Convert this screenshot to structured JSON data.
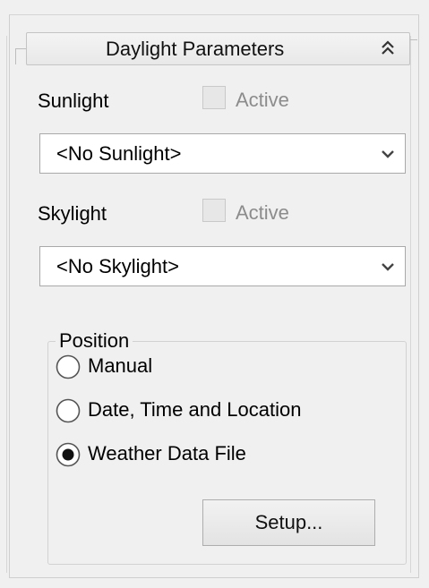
{
  "rollout": {
    "title": "Daylight Parameters",
    "collapse_icon": "double-chevron-up-icon"
  },
  "sunlight": {
    "label": "Sunlight",
    "active_label": "Active",
    "active_checked": false,
    "active_enabled": false,
    "dropdown_value": "<No Sunlight>"
  },
  "skylight": {
    "label": "Skylight",
    "active_label": "Active",
    "active_checked": false,
    "active_enabled": false,
    "dropdown_value": "<No Skylight>"
  },
  "position": {
    "title": "Position",
    "options": [
      {
        "label": "Manual",
        "selected": false
      },
      {
        "label": "Date, Time and Location",
        "selected": false
      },
      {
        "label": "Weather Data File",
        "selected": true
      }
    ],
    "setup_label": "Setup..."
  },
  "icons": {
    "dropdown": "chevron-down-icon",
    "collapse": "double-chevron-up-icon"
  },
  "colors": {
    "background": "#f0f0f0",
    "disabled_text": "#8c8c8c",
    "field_border": "#a9a9a9"
  }
}
